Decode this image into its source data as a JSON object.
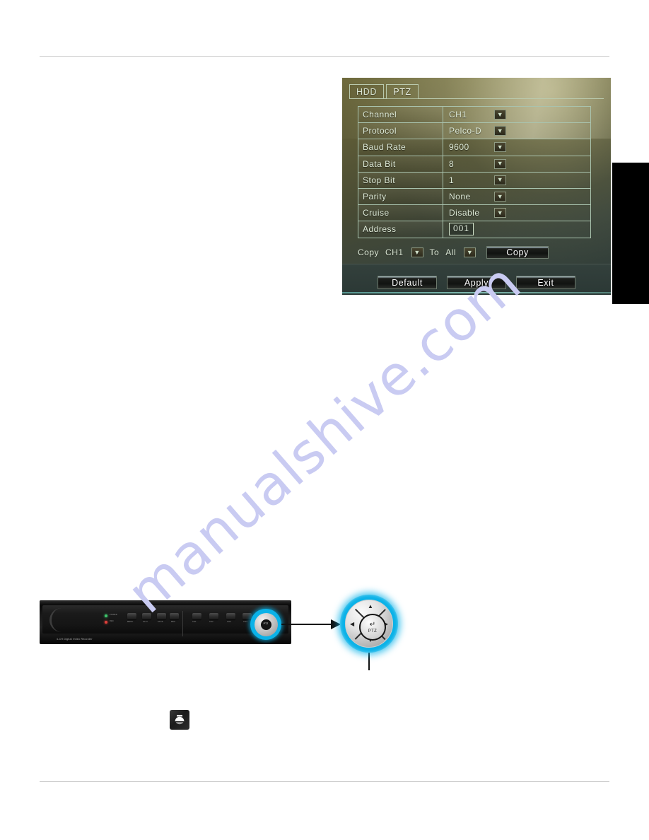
{
  "page": {
    "background_color": "#ffffff",
    "rule_color": "#c9c9c9",
    "section_tab_color": "#000000",
    "watermark_text": "manualshive.com",
    "watermark_color": "#c9cbf2"
  },
  "ptz_dialog": {
    "tabs": [
      {
        "label": "HDD",
        "active": false
      },
      {
        "label": "PTZ",
        "active": true
      }
    ],
    "settings": [
      {
        "label": "Channel",
        "value": "CH1",
        "control": "dropdown"
      },
      {
        "label": "Protocol",
        "value": "Pelco-D",
        "control": "dropdown"
      },
      {
        "label": "Baud Rate",
        "value": "9600",
        "control": "dropdown"
      },
      {
        "label": "Data Bit",
        "value": "8",
        "control": "dropdown"
      },
      {
        "label": "Stop Bit",
        "value": "1",
        "control": "dropdown"
      },
      {
        "label": "Parity",
        "value": "None",
        "control": "dropdown"
      },
      {
        "label": "Cruise",
        "value": "Disable",
        "control": "dropdown"
      },
      {
        "label": "Address",
        "value": "001",
        "control": "textbox"
      }
    ],
    "copy_row": {
      "copy_label": "Copy",
      "source_value": "CH1",
      "to_label": "To",
      "target_value": "All",
      "copy_button": "Copy"
    },
    "footer_buttons": [
      {
        "label": "Default"
      },
      {
        "label": "Apply"
      },
      {
        "label": "Exit"
      }
    ],
    "caret_glyph": "▼",
    "accent_color": "#8fd0c4",
    "text_color": "#dce8d6"
  },
  "dvr_figure": {
    "brand_text": "4-CH Digital Video Recorder",
    "led_labels": {
      "power": "POWER",
      "record": "REC"
    },
    "button_labels": [
      "MENU",
      "PLAY",
      "STOP",
      "REC",
      "PTZ/SET",
      "CH1",
      "CH2",
      "CH3",
      "CH4",
      "QUAD"
    ],
    "ring_highlight_color": "#0ab2e8",
    "center_button_label": "PTZ",
    "center_button_glyph": "↵",
    "arrow_glyphs": {
      "up": "▲",
      "down": "▼",
      "left": "◀",
      "right": "▶"
    }
  },
  "dome_icon": {
    "name": "ptz-dome-camera-icon",
    "background_color": "#1b1b1b",
    "glyph_color": "#ffffff"
  }
}
